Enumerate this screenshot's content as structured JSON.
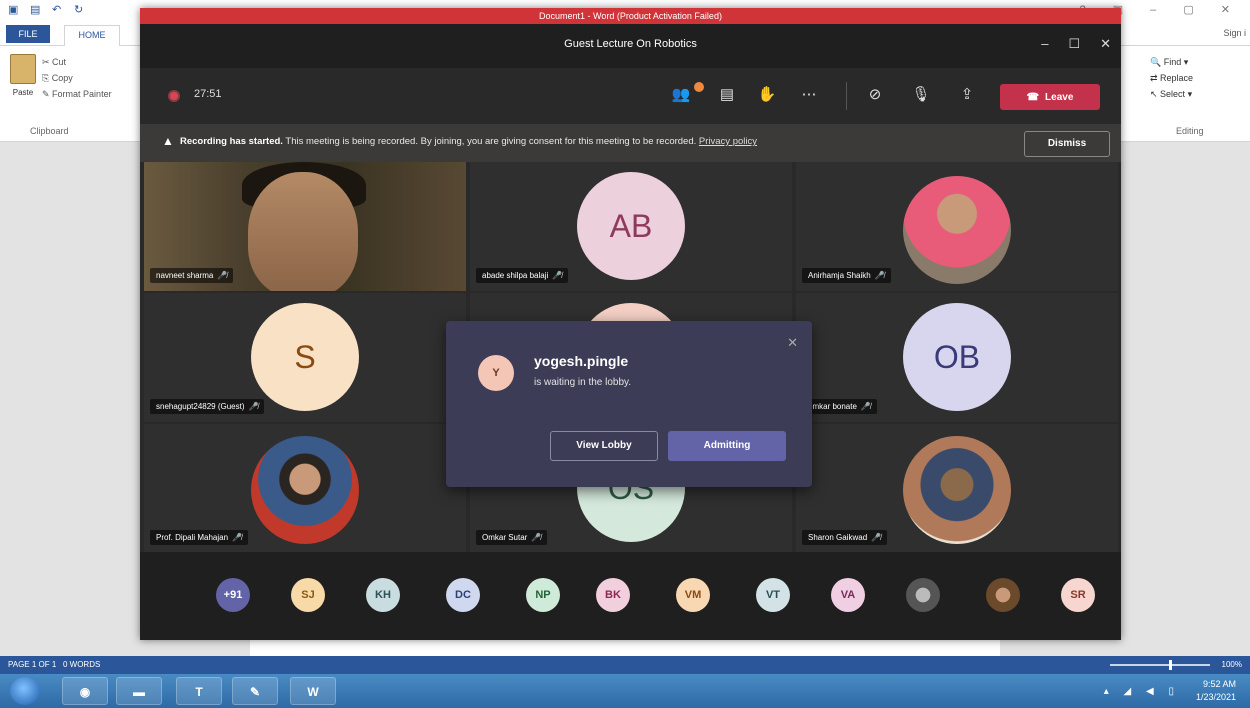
{
  "word": {
    "title": "Document1 - Word (Product Activation Failed)",
    "tab_file": "FILE",
    "tab_home": "HOME",
    "sign_in": "Sign i",
    "ribbon": {
      "paste": "Paste",
      "cut": "Cut",
      "copy": "Copy",
      "format_painter": "Format Painter",
      "clipboard_label": "Clipboard",
      "find": "Find",
      "replace": "Replace",
      "select": "Select",
      "editing_label": "Editing"
    },
    "status": {
      "page": "PAGE 1 OF 1",
      "words": "0 WORDS",
      "zoom": "100%"
    }
  },
  "taskbar": {
    "time": "9:52 AM",
    "date": "1/23/2021",
    "word_app_label": "W"
  },
  "teams": {
    "activation_banner": "Document1 - Word (Product Activation Failed)",
    "window_title": "Guest Lecture On Robotics",
    "timer": "27:51",
    "leave_label": "Leave",
    "recording_banner": {
      "bold": "Recording has started.",
      "text": " This meeting is being recorded. By joining, you are giving consent for this meeting to be recorded. ",
      "link": "Privacy policy",
      "dismiss": "Dismiss"
    },
    "tiles": [
      {
        "name": "navneet sharma",
        "kind": "video"
      },
      {
        "name": "abade shilpa balaji",
        "kind": "initials",
        "initials": "AB",
        "bg": "#ecd0dc",
        "fg": "#8e3a5a"
      },
      {
        "name": "Anirhamja Shaikh",
        "kind": "photo"
      },
      {
        "name": "snehagupt24829 (Guest)",
        "kind": "initials",
        "initials": "S",
        "bg": "#f9e1c6",
        "fg": "#8a4b12"
      },
      {
        "name": "",
        "kind": "initials",
        "initials": "",
        "bg": "#f3cfc4",
        "fg": "#8a3a2a"
      },
      {
        "name": "omkar bonate",
        "kind": "initials",
        "initials": "OB",
        "bg": "#d7d6ee",
        "fg": "#3b3a79"
      },
      {
        "name": "Prof. Dipali Mahajan",
        "kind": "photo"
      },
      {
        "name": "Omkar Sutar",
        "kind": "initials",
        "initials": "OS",
        "bg": "#d4e8dc",
        "fg": "#2d5c40"
      },
      {
        "name": "Sharon Gaikwad",
        "kind": "photo"
      }
    ],
    "lobby": {
      "initial": "Y",
      "name": "yogesh.pingle",
      "subtitle": "is waiting in the lobby.",
      "view_lobby": "View Lobby",
      "admit": "Admitting"
    },
    "strip": [
      {
        "label": "+91",
        "bg": "#6264a7",
        "fg": "#ffffff"
      },
      {
        "label": "SJ",
        "bg": "#f8d9a8",
        "fg": "#8a5a12"
      },
      {
        "label": "KH",
        "bg": "#c9dce0",
        "fg": "#2f5058"
      },
      {
        "label": "DC",
        "bg": "#cfd8ee",
        "fg": "#2d3f78"
      },
      {
        "label": "NP",
        "bg": "#cfead8",
        "fg": "#246338"
      },
      {
        "label": "BK",
        "bg": "#f1cfdd",
        "fg": "#8a2a52"
      },
      {
        "label": "VM",
        "bg": "#f8d8b2",
        "fg": "#8a4a12"
      },
      {
        "label": "VT",
        "bg": "#d3e2e6",
        "fg": "#2c4d55"
      },
      {
        "label": "VA",
        "bg": "#f0cfe2",
        "fg": "#7a2a5a"
      },
      {
        "label": "",
        "bg": "#777777",
        "fg": "#ffffff"
      },
      {
        "label": "",
        "bg": "#a07b5a",
        "fg": "#ffffff"
      },
      {
        "label": "SR",
        "bg": "#f6d6cf",
        "fg": "#8a3a2a"
      }
    ]
  }
}
